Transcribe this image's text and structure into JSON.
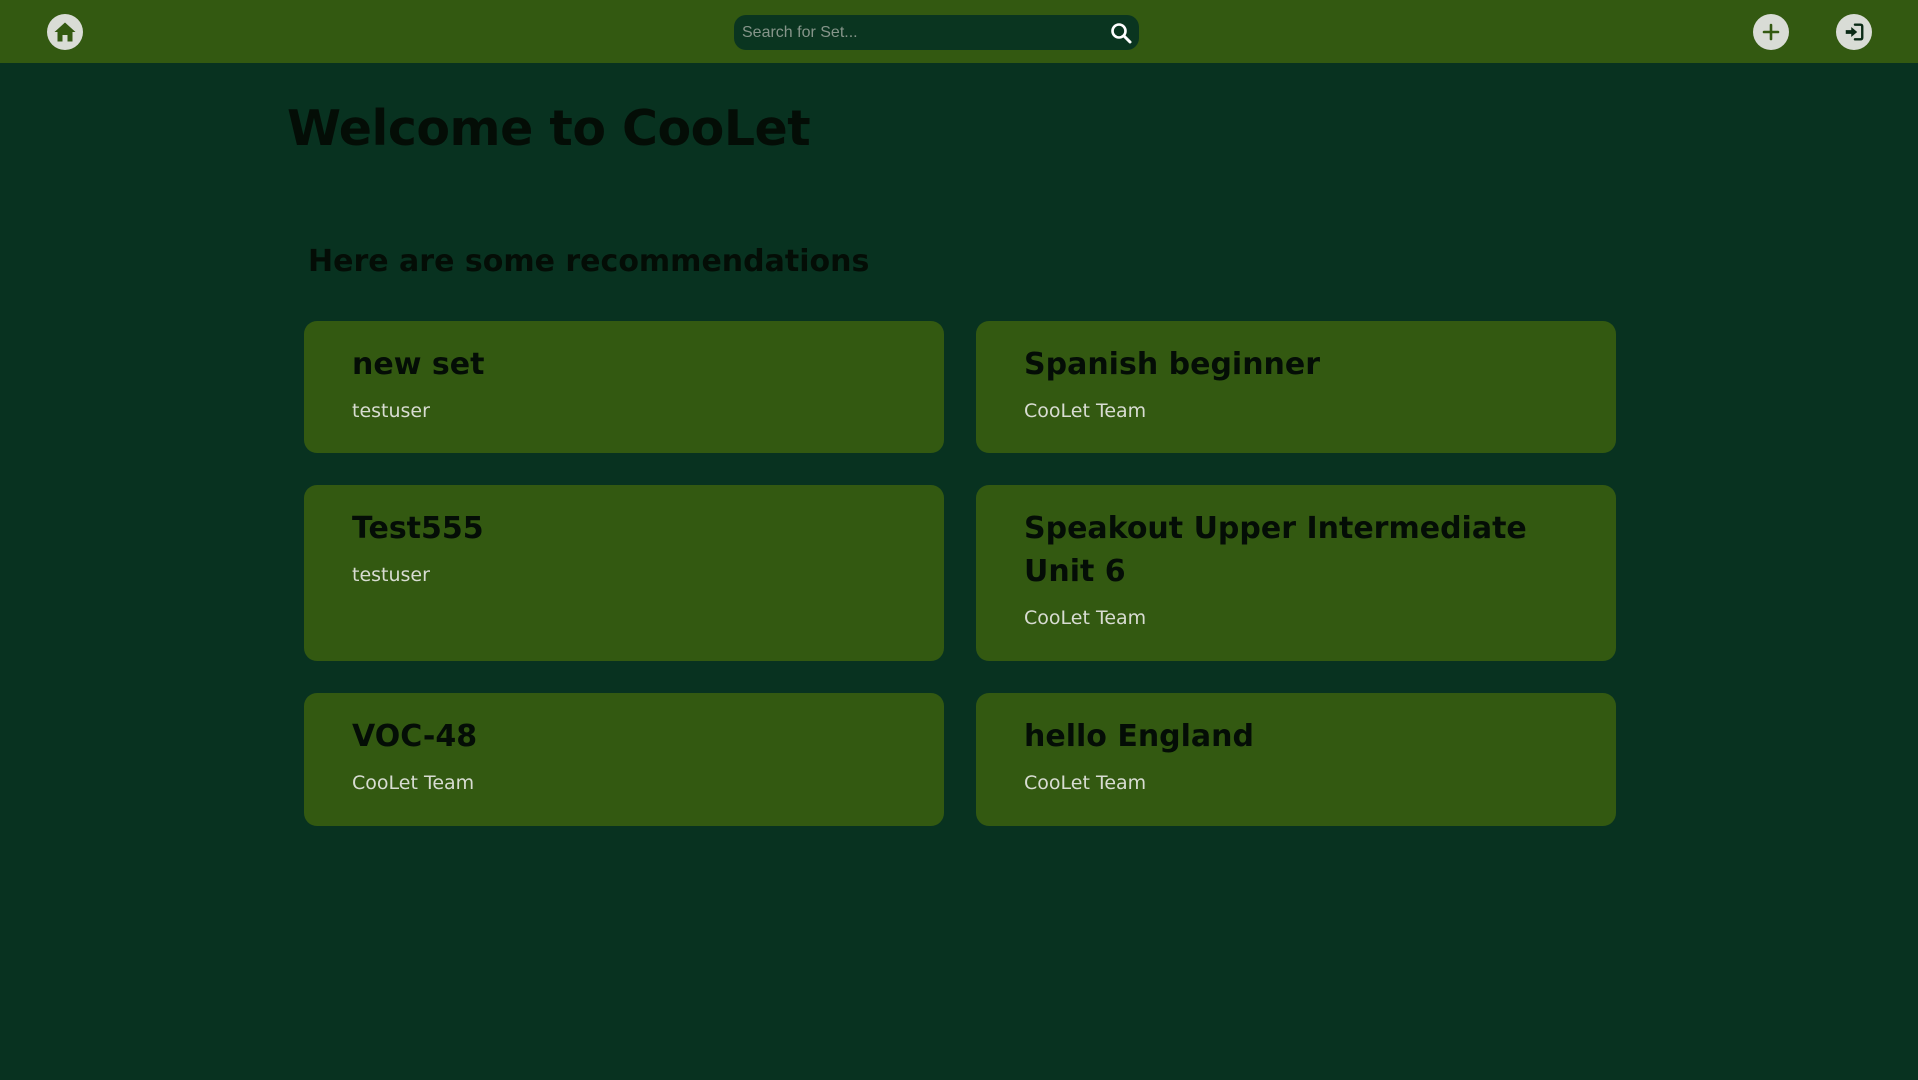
{
  "nav": {
    "home_icon": "home-icon",
    "add_icon": "plus-icon",
    "login_icon": "sign-in-icon"
  },
  "search": {
    "placeholder": "Search for Set...",
    "value": "",
    "icon": "search-icon"
  },
  "main": {
    "welcome": "Welcome to CooLet",
    "recommendations_heading": "Here are some recommendations"
  },
  "sets": [
    {
      "title": "new set",
      "author": "testuser"
    },
    {
      "title": "Spanish beginner",
      "author": "CooLet Team"
    },
    {
      "title": "Test555",
      "author": "testuser"
    },
    {
      "title": "Speakout Upper Intermediate Unit 6",
      "author": "CooLet Team"
    },
    {
      "title": "VOC-48",
      "author": "CooLet Team"
    },
    {
      "title": "hello England",
      "author": "CooLet Team"
    }
  ],
  "colors": {
    "page_background": "#083220",
    "topbar": "#335911",
    "card": "#335911",
    "search_background": "#0a3520",
    "heading_text": "#040d06",
    "author_text": "#d8dcd2"
  }
}
